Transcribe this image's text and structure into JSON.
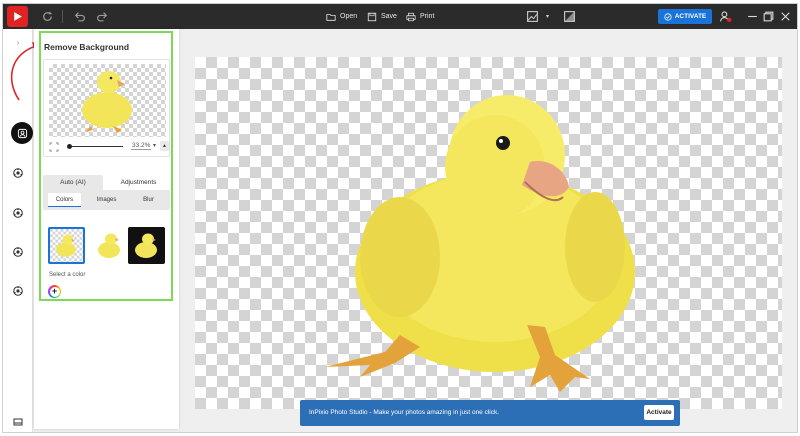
{
  "toolbar": {
    "open_label": "Open",
    "save_label": "Save",
    "print_label": "Print",
    "activate_label": "ACTIVATE"
  },
  "panel": {
    "title": "Remove Background",
    "zoom_value": "33.2%",
    "mode_tabs": [
      "Auto (AI)",
      "Adjustments"
    ],
    "sub_tabs": [
      "Colors",
      "Images",
      "Blur"
    ],
    "select_color_label": "Select a color",
    "active_mode": "Auto (AI)",
    "active_sub_tab": "Colors"
  },
  "toast": {
    "message": "InPixio Photo Studio - Make your photos amazing in just one click.",
    "button_label": "Activate"
  },
  "icons": {
    "app": "app-logo-icon",
    "rotate": "rotate-icon",
    "undo": "undo-icon",
    "redo": "redo-icon",
    "open": "folder-icon",
    "save": "save-icon",
    "print": "printer-icon",
    "image": "image-icon",
    "compare": "compare-icon",
    "account": "account-icon"
  },
  "colors": {
    "topbar": "#2b2b2b",
    "accent": "#1a73d9",
    "highlight": "#7ed957",
    "toast": "#2c6fb7",
    "logo": "#e02424"
  }
}
